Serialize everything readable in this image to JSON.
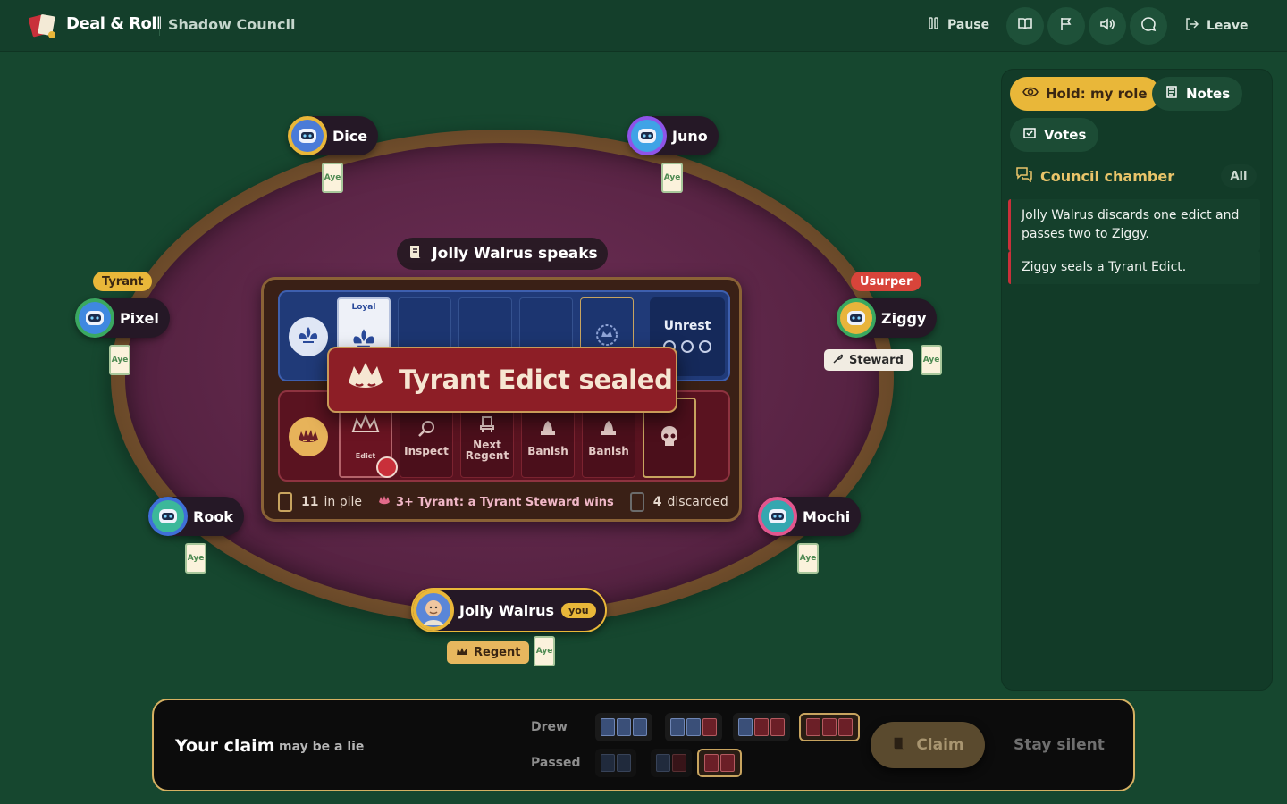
{
  "header": {
    "brand": "Deal & Roll",
    "game_name": "Shadow Council",
    "pause_label": "Pause",
    "leave_label": "Leave",
    "icon_buttons": [
      "book-icon",
      "flag-icon",
      "sound-icon",
      "chat-icon"
    ]
  },
  "table": {
    "speaker_banner": "Jolly Walrus speaks",
    "loyal_track": {
      "filled_label": "Loyal",
      "unrest_label": "Unrest",
      "unrest_total": 3,
      "unrest_filled": 0
    },
    "tyrant_track": {
      "placed_label": "Edict",
      "powers": [
        "Inspect",
        "Next Regent",
        "Banish",
        "Banish"
      ]
    },
    "stats": {
      "pile_count": "11",
      "pile_label": "in pile",
      "rule_text": "3+ Tyrant: a Tyrant Steward wins",
      "discard_count": "4",
      "discard_label": "discarded"
    },
    "event_banner": "Tyrant Edict sealed"
  },
  "players": [
    {
      "name": "Dice",
      "vote": "Aye",
      "ring": "#e9b739",
      "face": "#4a7bd8"
    },
    {
      "name": "Juno",
      "vote": "Aye",
      "ring": "#8e54e9",
      "face": "#3fa3e6"
    },
    {
      "name": "Pixel",
      "vote": "Aye",
      "ring": "#3aa860",
      "face": "#3f88e0",
      "badge": "Tyrant"
    },
    {
      "name": "Ziggy",
      "vote": "Aye",
      "ring": "#3aa860",
      "face": "#e8b43b",
      "badge": "Usurper",
      "role": "Steward"
    },
    {
      "name": "Rook",
      "vote": "Aye",
      "ring": "#3f6fd8",
      "face": "#3bb89a"
    },
    {
      "name": "Mochi",
      "vote": "Aye",
      "ring": "#e2568e",
      "face": "#35a7b0"
    },
    {
      "name": "Jolly Walrus",
      "vote": "Aye",
      "ring": "#e9b739",
      "face": "#5a86d8",
      "you": "you",
      "role": "Regent"
    }
  ],
  "side_panel": {
    "hold_role_label": "Hold: my role",
    "notes_label": "Notes",
    "votes_label": "Votes",
    "chamber_title": "Council chamber",
    "filter_label": "All",
    "messages": [
      "Jolly Walrus discards one edict and passes two to Ziggy.",
      "Ziggy seals a Tyrant Edict."
    ]
  },
  "claim_bar": {
    "title": "Your claim",
    "subtitle": "may be a lie",
    "drew_label": "Drew",
    "passed_label": "Passed",
    "drew_options": [
      [
        "b",
        "b",
        "b"
      ],
      [
        "b",
        "b",
        "r"
      ],
      [
        "b",
        "r",
        "r"
      ],
      [
        "r",
        "r",
        "r"
      ]
    ],
    "passed_options": [
      [
        "b",
        "b"
      ],
      [
        "b",
        "r"
      ],
      [
        "r",
        "r"
      ]
    ],
    "selected_drew": 3,
    "selected_passed": 2,
    "claim_label": "Claim",
    "silent_label": "Stay silent"
  },
  "colors": {
    "background": "#16472f",
    "felt": "#5b2546",
    "accent_gold": "#e9c46a",
    "tyrant_red": "#8d1e26",
    "loyal_blue": "#203a78"
  }
}
